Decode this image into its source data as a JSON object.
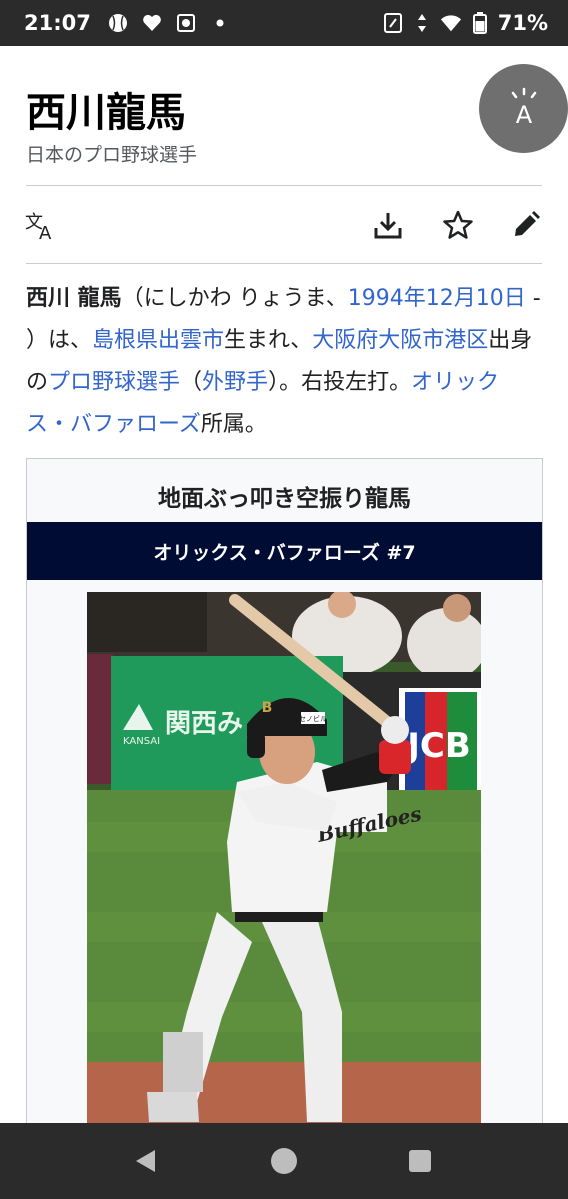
{
  "status_bar": {
    "time": "21:07",
    "battery": "71%",
    "icons": [
      "baseball-icon",
      "heart-icon",
      "soccer-ball-icon",
      "dot-icon",
      "nfc-icon",
      "data-arrows-icon",
      "wifi-icon",
      "battery-icon"
    ]
  },
  "page": {
    "title": "西川龍馬",
    "subtitle": "日本のプロ野球選手"
  },
  "toolbar": {
    "icons": [
      "translate-icon",
      "download-icon",
      "star-icon",
      "edit-pencil-icon"
    ]
  },
  "lead": {
    "name_bold": "西川 龍馬",
    "reading": "（にしかわ りょうま、",
    "birth_date": "1994年12月10日",
    "text_after_date": " - ）は、",
    "birthplace_link": "島根県出雲市",
    "text_born": "生まれ、",
    "origin_link": "大阪府大阪市港区",
    "text_origin": "出身の",
    "profession_link": "プロ野球選手",
    "paren_open": "（",
    "position_link": "外野手",
    "text_position": "）。右投左打。",
    "team_link": "オリックス・バファローズ",
    "text_end": "所属。"
  },
  "infobox": {
    "title": "地面ぶっ叩き空振り龍馬",
    "team_number": "オリックス・バファローズ #7",
    "band_color": "#000c33",
    "photo": {
      "banner_text": "関西み",
      "banner_sub": "KANSAI",
      "sign_text": "JCB",
      "jersey_text": "Buffaloes",
      "helmet_badge": "B",
      "helmet_sticker": "セノビル"
    }
  },
  "nav_bar": {
    "icons": [
      "back-triangle-icon",
      "home-circle-icon",
      "recents-square-icon"
    ]
  },
  "colors": {
    "link": "#3366cc",
    "text": "#202122",
    "status_bar": "#2b2b2b"
  }
}
